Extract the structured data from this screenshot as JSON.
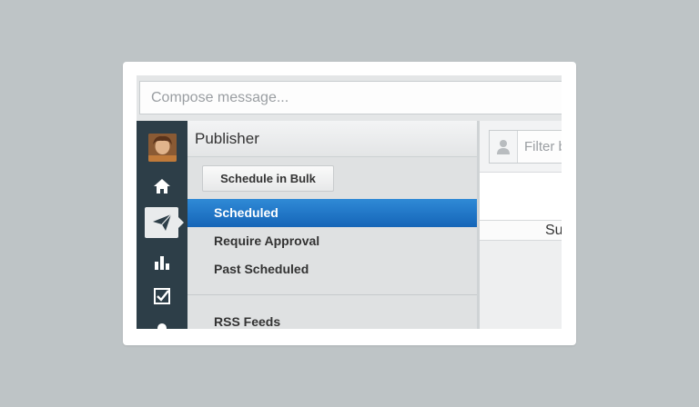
{
  "compose": {
    "placeholder": "Compose message..."
  },
  "nav": {
    "icons": [
      "avatar",
      "home-icon",
      "send-icon",
      "bar-chart-icon",
      "checkbox-icon",
      "more-icon"
    ],
    "active": "send-icon"
  },
  "panel": {
    "title": "Publisher",
    "bulk_button": "Schedule in Bulk",
    "items": [
      {
        "label": "Scheduled",
        "selected": true
      },
      {
        "label": "Require Approval",
        "selected": false
      },
      {
        "label": "Past Scheduled",
        "selected": false
      },
      {
        "label": "RSS Feeds",
        "selected": false
      }
    ]
  },
  "content": {
    "filter_placeholder": "Filter b",
    "column_header": "Su"
  },
  "colors": {
    "selected": "#1f78c8",
    "nav_bg": "#2d3e48",
    "page_bg": "#bec4c6"
  }
}
